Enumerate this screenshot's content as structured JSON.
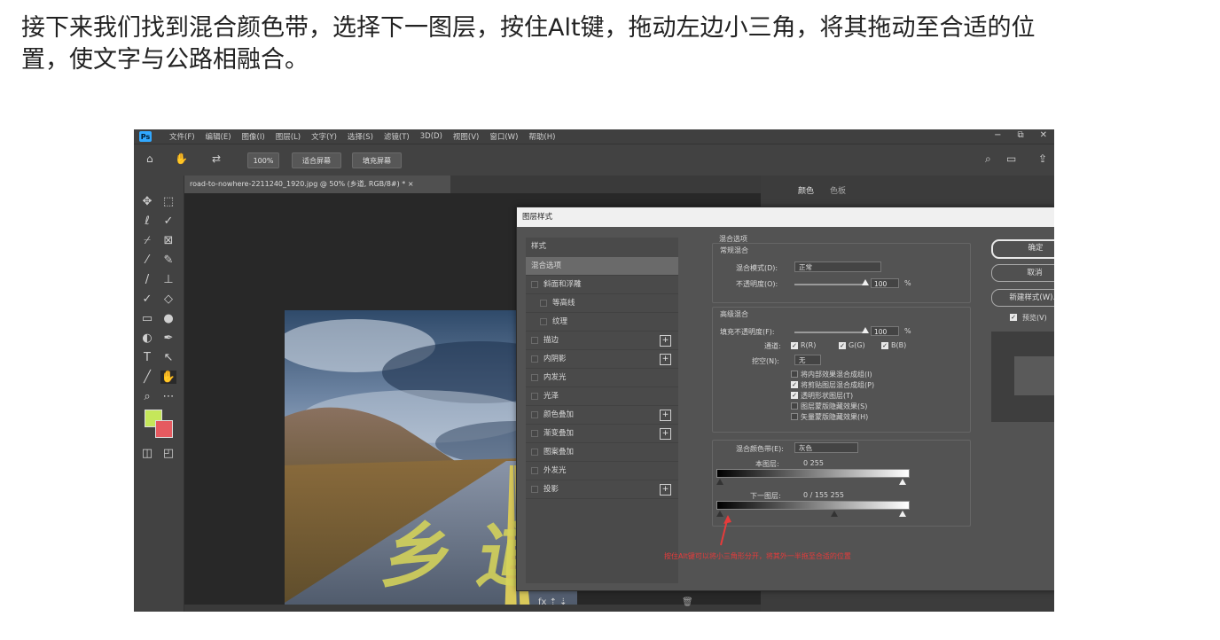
{
  "article": {
    "paragraph_line1": "接下来我们找到混合颜色带，选择下一图层，按住Alt键，拖动左边小三角，将其拖动至合适的位",
    "paragraph_line2": "置，使文字与公路相融合。"
  },
  "photoshop": {
    "app_logo": "Ps",
    "menu": [
      "文件(F)",
      "编辑(E)",
      "图像(I)",
      "图层(L)",
      "文字(Y)",
      "选择(S)",
      "滤镜(T)",
      "3D(D)",
      "视图(V)",
      "窗口(W)",
      "帮助(H)"
    ],
    "window_controls": [
      "−",
      "⧉",
      "✕"
    ],
    "options": {
      "zoom": "100%",
      "fit_screen": "适合屏幕",
      "fill_screen": "填充屏幕"
    },
    "document_tab": "road-to-nowhere-2211240_1920.jpg @ 50% (乡道, RGB/8#) * ×",
    "panel_tabs": [
      "颜色",
      "色板"
    ],
    "photo_text": "乡 道",
    "dialog": {
      "title": "图层样式",
      "styles_header": "样式",
      "style_items": [
        {
          "label": "混合选项",
          "checkbox": false,
          "plus": false,
          "selected": true,
          "indent": 0
        },
        {
          "label": "斜面和浮雕",
          "checkbox": true,
          "plus": false,
          "selected": false,
          "indent": 0
        },
        {
          "label": "等高线",
          "checkbox": true,
          "plus": false,
          "selected": false,
          "indent": 1
        },
        {
          "label": "纹理",
          "checkbox": true,
          "plus": false,
          "selected": false,
          "indent": 1
        },
        {
          "label": "描边",
          "checkbox": true,
          "plus": true,
          "selected": false,
          "indent": 0
        },
        {
          "label": "内阴影",
          "checkbox": true,
          "plus": true,
          "selected": false,
          "indent": 0
        },
        {
          "label": "内发光",
          "checkbox": true,
          "plus": false,
          "selected": false,
          "indent": 0
        },
        {
          "label": "光泽",
          "checkbox": true,
          "plus": false,
          "selected": false,
          "indent": 0
        },
        {
          "label": "颜色叠加",
          "checkbox": true,
          "plus": true,
          "selected": false,
          "indent": 0
        },
        {
          "label": "渐变叠加",
          "checkbox": true,
          "plus": true,
          "selected": false,
          "indent": 0
        },
        {
          "label": "图案叠加",
          "checkbox": true,
          "plus": false,
          "selected": false,
          "indent": 0
        },
        {
          "label": "外发光",
          "checkbox": true,
          "plus": false,
          "selected": false,
          "indent": 0
        },
        {
          "label": "投影",
          "checkbox": true,
          "plus": true,
          "selected": false,
          "indent": 0
        }
      ],
      "list_footer": "fx ⇡ ⇣",
      "trash_icon": "🗑",
      "blend_options_title": "混合选项",
      "general_blend": "常规混合",
      "blend_mode_label": "混合模式(D):",
      "blend_mode_value": "正常",
      "opacity_label": "不透明度(O):",
      "opacity_value": "100",
      "opacity_fraction": 1.0,
      "percent": "%",
      "advanced_blend": "高级混合",
      "fill_opacity_label": "填充不透明度(F):",
      "fill_opacity_value": "100",
      "fill_opacity_fraction": 1.0,
      "channels_label": "通道:",
      "channel_r": "R(R)",
      "channel_g": "G(G)",
      "channel_b": "B(B)",
      "knockout_label": "挖空(N):",
      "knockout_value": "无",
      "adv_checks": [
        {
          "label": "将内部效果混合成组(I)",
          "on": false
        },
        {
          "label": "将剪贴图层混合成组(P)",
          "on": true
        },
        {
          "label": "透明形状图层(T)",
          "on": true
        },
        {
          "label": "图层蒙版隐藏效果(S)",
          "on": false
        },
        {
          "label": "矢量蒙版隐藏效果(H)",
          "on": false
        }
      ],
      "blend_if_label": "混合颜色带(E):",
      "blend_if_value": "灰色",
      "this_layer_label": "本图层:",
      "this_layer_values": "0        255",
      "underlying_label": "下一图层:",
      "underlying_values": "0  /  155    255",
      "underlying_split_left": 0,
      "underlying_split_right": 155,
      "underlying_max": 255,
      "annotation": "按住Alt键可以将小三角形分开，将其外一半拖至合适的位置",
      "buttons": {
        "ok": "确定",
        "cancel": "取消",
        "new_style": "新建样式(W)...",
        "preview": "预览(V)"
      }
    }
  },
  "colors": {
    "foreground": "#c5e75a",
    "background": "#e55a60",
    "annotation": "#e63b3b",
    "ps_blue": "#31a8ff"
  }
}
